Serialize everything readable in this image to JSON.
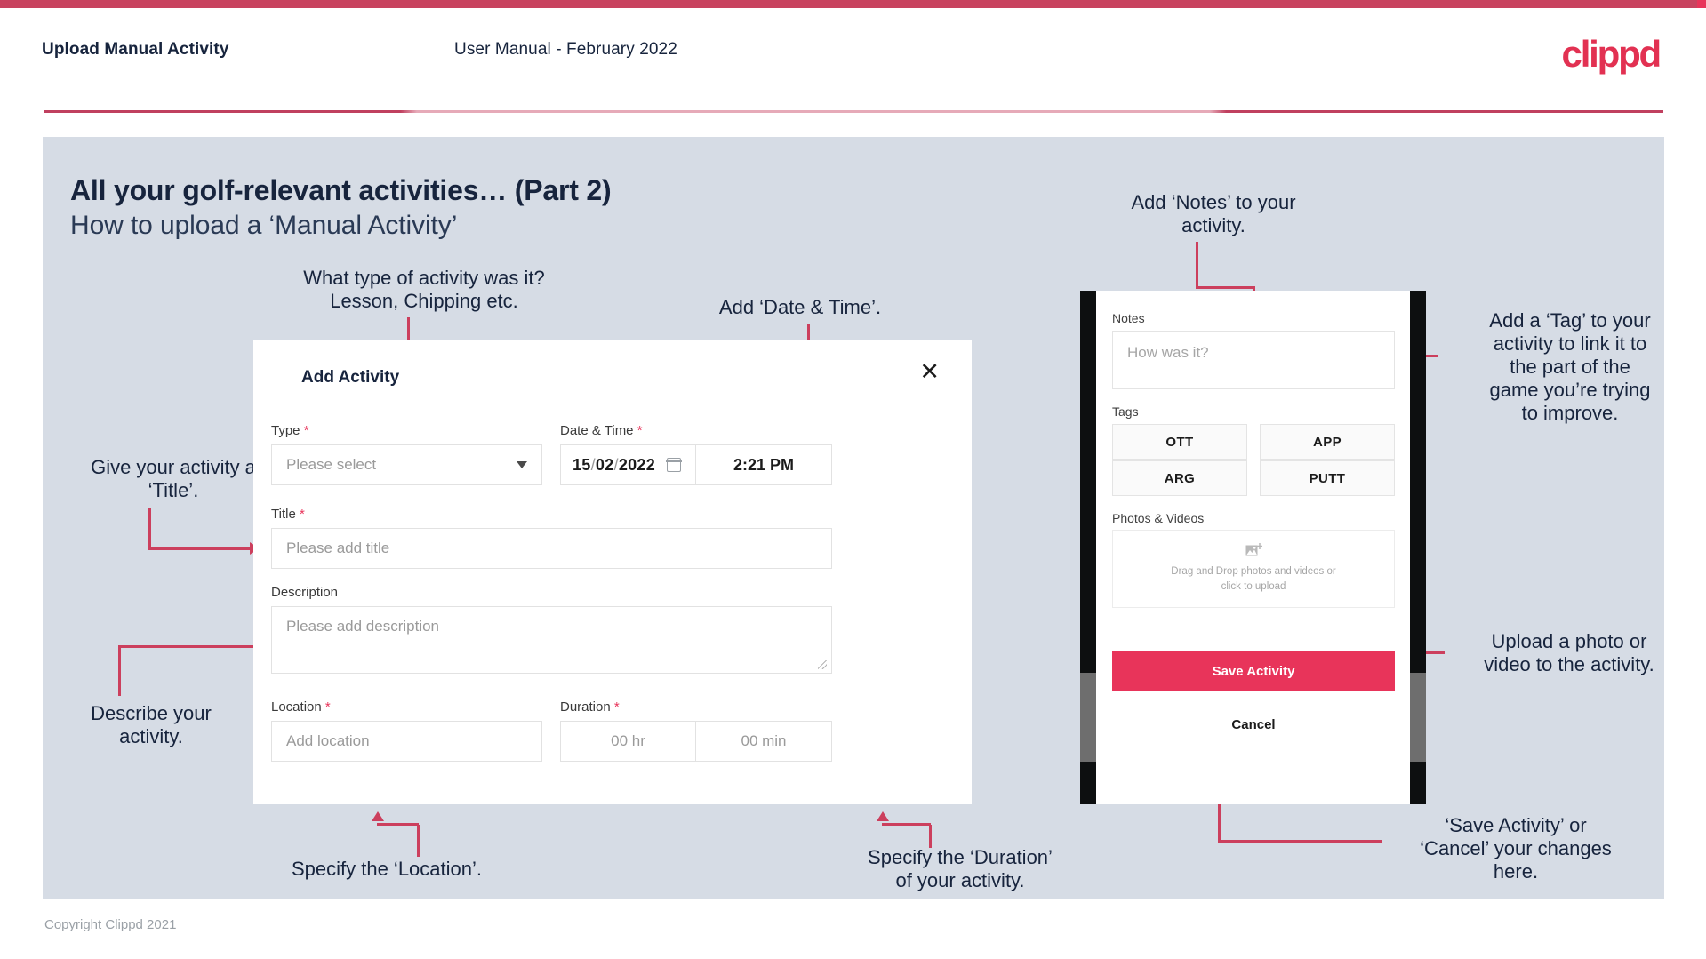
{
  "header": {
    "title": "Upload Manual Activity",
    "subtitle": "User Manual - February 2022",
    "logo": "clippd"
  },
  "slide": {
    "title": "All your golf-relevant activities… (Part 2)",
    "subtitle": "How to upload a ‘Manual Activity’"
  },
  "annotations": {
    "type": "What type of activity was it?\nLesson, Chipping etc.",
    "date_time": "Add ‘Date & Time’.",
    "title": "Give your activity a\n‘Title’.",
    "description": "Describe your\nactivity.",
    "location": "Specify the ‘Location’.",
    "duration": "Specify the ‘Duration’\nof your activity.",
    "notes": "Add ‘Notes’ to your\nactivity.",
    "tags": "Add a ‘Tag’ to your\nactivity to link it to\nthe part of the\ngame you’re trying\nto improve.",
    "photos": "Upload a photo or\nvideo to the activity.",
    "save": "‘Save Activity’ or\n‘Cancel’ your changes\nhere."
  },
  "dialog": {
    "title": "Add Activity",
    "close_icon": "close-icon",
    "fields": {
      "type": {
        "label": "Type",
        "required": true,
        "placeholder": "Please select"
      },
      "date_time": {
        "label": "Date & Time",
        "required": true,
        "day": "15",
        "month": "02",
        "year": "2022",
        "separator": "/",
        "time": "2:21 PM",
        "calendar_icon": "calendar-icon"
      },
      "title": {
        "label": "Title",
        "required": true,
        "placeholder": "Please add title"
      },
      "description": {
        "label": "Description",
        "required": false,
        "placeholder": "Please add description"
      },
      "location": {
        "label": "Location",
        "required": true,
        "placeholder": "Add location"
      },
      "duration": {
        "label": "Duration",
        "required": true,
        "hours": "00 hr",
        "minutes": "00 min"
      }
    },
    "required_marker": "*"
  },
  "phone": {
    "notes": {
      "label": "Notes",
      "placeholder": "How was it?"
    },
    "tags": {
      "label": "Tags",
      "items": [
        "OTT",
        "APP",
        "ARG",
        "PUTT"
      ]
    },
    "photos": {
      "label": "Photos & Videos",
      "dropzone_line1": "Drag and Drop photos and videos or",
      "dropzone_line2": "click to upload",
      "icon": "add-image-icon"
    },
    "save_label": "Save Activity",
    "cancel_label": "Cancel"
  },
  "footer": {
    "copyright": "Copyright Clippd 2021"
  },
  "colors": {
    "brand_pink": "#e8345a",
    "accent_crimson": "#c8435f",
    "panel_bg": "#d6dce5",
    "text_dark": "#17243d",
    "arrow": "#cc3f5d"
  }
}
